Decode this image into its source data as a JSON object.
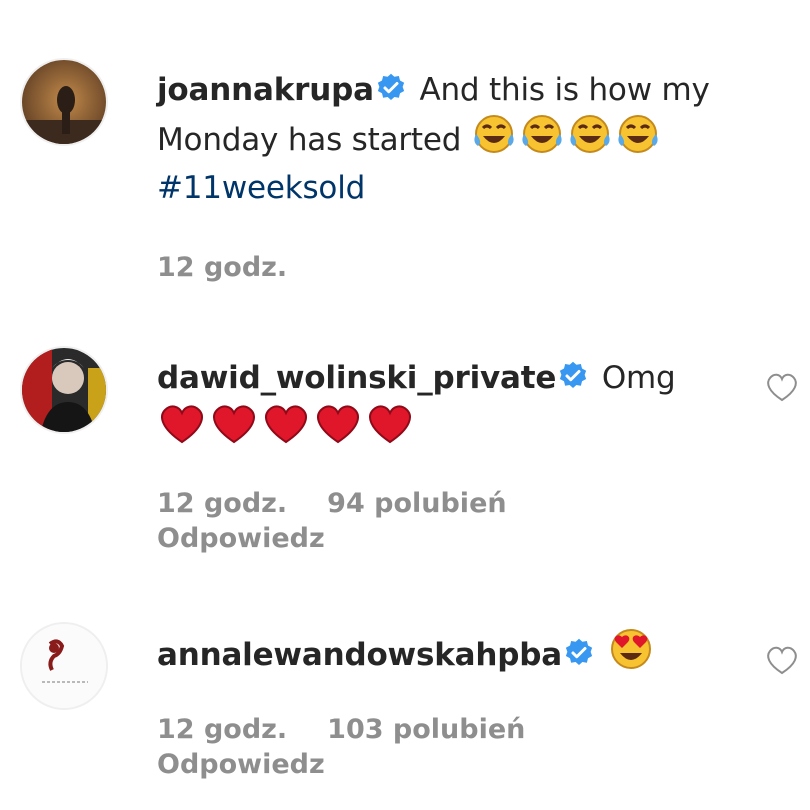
{
  "comments": [
    {
      "username": "joannakrupa",
      "text_line1": "And this is how my",
      "text_line2": "Monday has started",
      "hashtag": "#11weeksold",
      "time": "12 godz.",
      "emoji": "face-with-tears-of-joy x4"
    },
    {
      "username": "dawid_wolinski_private",
      "text": "Omg",
      "time": "12 godz.",
      "likes": "94 polubień",
      "reply": "Odpowiedz",
      "emoji": "red-heart x5"
    },
    {
      "username": "annalewandowskahpba",
      "time": "12 godz.",
      "likes": "103 polubień",
      "reply": "Odpowiedz",
      "emoji": "heart-eyes"
    }
  ],
  "colors": {
    "verified": "#3897f0",
    "meta": "#8e8e8e",
    "hashtag": "#003569",
    "text": "#262626"
  }
}
